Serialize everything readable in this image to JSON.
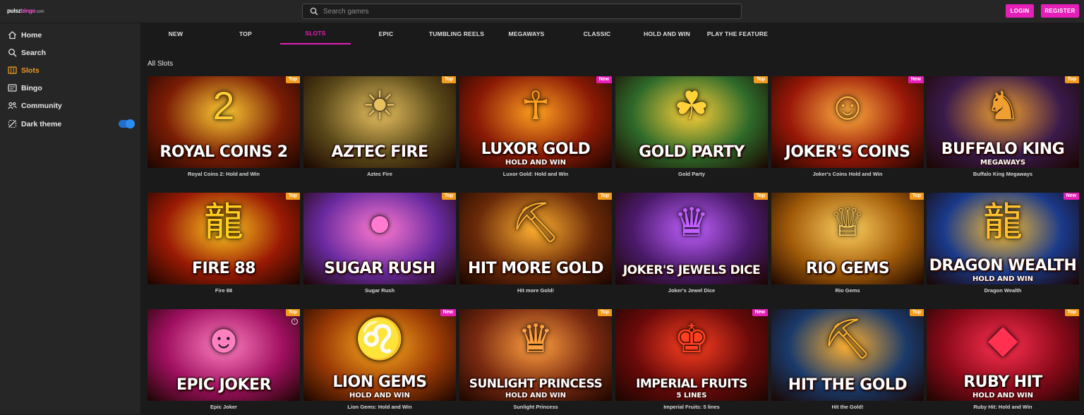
{
  "header": {
    "logo_main": "pulsz",
    "logo_accent": "bingo",
    "logo_suffix": ".com",
    "search_placeholder": "Search games",
    "login_label": "LOGIN",
    "register_label": "REGISTER"
  },
  "sidebar": {
    "items": [
      {
        "label": "Home",
        "icon": "home-icon"
      },
      {
        "label": "Search",
        "icon": "search-icon"
      },
      {
        "label": "Slots",
        "icon": "slots-icon",
        "active": true
      },
      {
        "label": "Bingo",
        "icon": "bingo-icon"
      },
      {
        "label": "Community",
        "icon": "community-icon"
      },
      {
        "label": "Dark theme",
        "icon": "dark-theme-icon",
        "toggle": true
      }
    ]
  },
  "tabs": [
    {
      "label": "NEW"
    },
    {
      "label": "TOP"
    },
    {
      "label": "SLOTS",
      "active": true
    },
    {
      "label": "EPIC"
    },
    {
      "label": "TUMBLING REELS"
    },
    {
      "label": "MEGAWAYS"
    },
    {
      "label": "CLASSIC"
    },
    {
      "label": "HOLD AND WIN"
    },
    {
      "label": "PLAY THE FEATURE"
    }
  ],
  "section_title": "All Slots",
  "games": [
    {
      "caption": "Royal Coins 2: Hold and Win",
      "title": "ROYAL COINS 2",
      "sub": "",
      "badge": "Top",
      "art": "2",
      "bg": "#7a1d05",
      "glow": "#ffcc33"
    },
    {
      "caption": "Aztec Fire",
      "title": "AZTEC FIRE",
      "sub": "",
      "badge": "Top",
      "art": "☀",
      "bg": "#5b4a1a",
      "glow": "#e8c060"
    },
    {
      "caption": "Luxor Gold: Hold and Win",
      "title": "LUXOR GOLD",
      "sub": "HOLD AND WIN",
      "badge": "New",
      "art": "☥",
      "bg": "#8a1a05",
      "glow": "#ffa020"
    },
    {
      "caption": "Gold Party",
      "title": "GOLD PARTY",
      "sub": "",
      "badge": "Top",
      "art": "☘",
      "bg": "#2e6a2a",
      "glow": "#ffd23a"
    },
    {
      "caption": "Joker's Coins Hold and Win",
      "title": "JOKER'S COINS",
      "sub": "",
      "badge": "New",
      "art": "☺",
      "bg": "#9a1808",
      "glow": "#ffb040"
    },
    {
      "caption": "Buffalo King Megaways",
      "title": "BUFFALO KING",
      "sub": "MEGAWAYS",
      "badge": "Top",
      "art": "♞",
      "bg": "#3a1a4a",
      "glow": "#f0a030"
    },
    {
      "caption": "Fire 88",
      "title": "FIRE 88",
      "sub": "",
      "badge": "Top",
      "art": "龍",
      "bg": "#9a1a04",
      "glow": "#ffcc20"
    },
    {
      "caption": "Sugar Rush",
      "title": "SUGAR RUSH",
      "sub": "",
      "badge": "Top",
      "art": "●",
      "bg": "#6a2aa0",
      "glow": "#ff7ad0"
    },
    {
      "caption": "Hit more Gold!",
      "title": "HIT MORE GOLD",
      "sub": "",
      "badge": "Top",
      "art": "⛏",
      "bg": "#6a2a08",
      "glow": "#ffb030"
    },
    {
      "caption": "Joker's Jewel Dice",
      "title": "JOKER'S JEWELS DICE",
      "sub": "",
      "badge": "Top",
      "art": "♛",
      "bg": "#4a1a6a",
      "glow": "#c060ff"
    },
    {
      "caption": "Rio Gems",
      "title": "RIO GEMS",
      "sub": "",
      "badge": "Top",
      "art": "♕",
      "bg": "#a05a08",
      "glow": "#ffd060"
    },
    {
      "caption": "Dragon Wealth",
      "title": "DRAGON WEALTH",
      "sub": "HOLD AND WIN",
      "badge": "New",
      "art": "龍",
      "bg": "#1a3a8a",
      "glow": "#ffc030"
    },
    {
      "caption": "Epic Joker",
      "title": "EPIC JOKER",
      "sub": "",
      "badge": "Top",
      "art": "☻",
      "bg": "#a01060",
      "glow": "#ff80c0"
    },
    {
      "caption": "Lion Gems: Hold and Win",
      "title": "LION GEMS",
      "sub": "HOLD AND WIN",
      "badge": "New",
      "art": "♌",
      "bg": "#9a3a05",
      "glow": "#ffb020"
    },
    {
      "caption": "Sunlight Princess",
      "title": "SUNLIGHT PRINCESS",
      "sub": "HOLD AND WIN",
      "badge": "Top",
      "art": "♛",
      "bg": "#7a2a10",
      "glow": "#ffa040"
    },
    {
      "caption": "Imperial Fruits: 5 lines",
      "title": "IMPERIAL FRUITS",
      "sub": "5 LINES",
      "badge": "New",
      "art": "♚",
      "bg": "#6a0a0a",
      "glow": "#ff4020"
    },
    {
      "caption": "Hit the Gold!",
      "title": "HIT THE GOLD",
      "sub": "",
      "badge": "Top",
      "art": "⛏",
      "bg": "#1a3a6a",
      "glow": "#ffb030"
    },
    {
      "caption": "Ruby Hit: Hold and Win",
      "title": "RUBY HIT",
      "sub": "HOLD AND WIN",
      "badge": "Top",
      "art": "◆",
      "bg": "#8a0a1a",
      "glow": "#ff3050"
    }
  ]
}
